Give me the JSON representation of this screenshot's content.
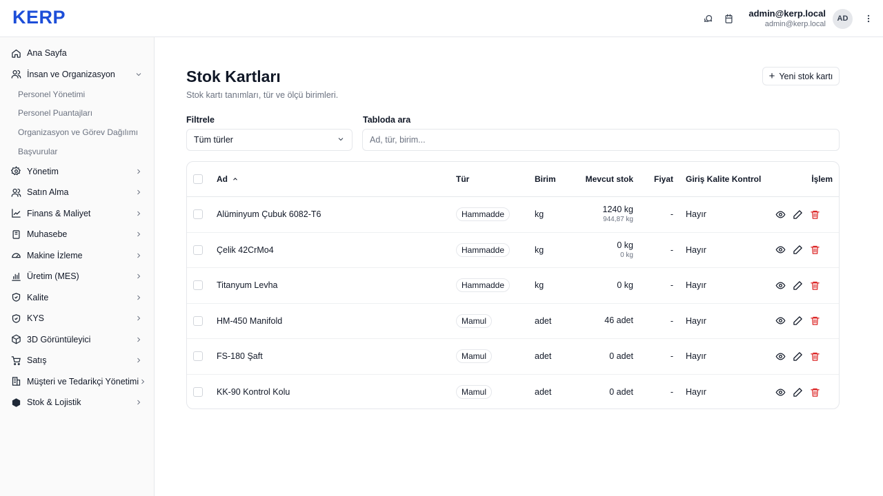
{
  "header": {
    "logo": "KERP",
    "user_name": "admin@kerp.local",
    "user_email": "admin@kerp.local",
    "avatar_initials": "AD"
  },
  "sidebar": {
    "items": [
      {
        "label": "Ana Sayfa"
      },
      {
        "label": "İnsan ve Organizasyon"
      },
      {
        "label": "Yönetim"
      },
      {
        "label": "Satın Alma"
      },
      {
        "label": "Finans & Maliyet"
      },
      {
        "label": "Muhasebe"
      },
      {
        "label": "Makine İzleme"
      },
      {
        "label": "Üretim (MES)"
      },
      {
        "label": "Kalite"
      },
      {
        "label": "KYS"
      },
      {
        "label": "3D Görüntüleyici"
      },
      {
        "label": "Satış"
      },
      {
        "label": "Müşteri ve Tedarikçi Yönetimi"
      },
      {
        "label": "Stok & Lojistik"
      }
    ],
    "sub_items": [
      {
        "label": "Personel Yönetimi"
      },
      {
        "label": "Personel Puantajları"
      },
      {
        "label": "Organizasyon ve Görev Dağılımı"
      },
      {
        "label": "Başvurular"
      }
    ]
  },
  "page": {
    "title": "Stok Kartları",
    "subtitle": "Stok kartı tanımları, tür ve ölçü birimleri.",
    "new_button": "Yeni stok kartı",
    "filter_label": "Filtrele",
    "filter_value": "Tüm türler",
    "search_label": "Tabloda ara",
    "search_placeholder": "Ad, tür, birim..."
  },
  "table": {
    "headers": {
      "ad": "Ad",
      "tur": "Tür",
      "birim": "Birim",
      "stok": "Mevcut stok",
      "fiyat": "Fiyat",
      "kk": "Giriş Kalite Kontrol",
      "islem": "İşlem"
    },
    "rows": [
      {
        "ad": "Alüminyum Çubuk 6082-T6",
        "tur": "Hammadde",
        "birim": "kg",
        "stok": "1240 kg",
        "stok_sub": "944,87 kg",
        "fiyat": "-",
        "kk": "Hayır"
      },
      {
        "ad": "Çelik 42CrMo4",
        "tur": "Hammadde",
        "birim": "kg",
        "stok": "0 kg",
        "stok_sub": "0 kg",
        "fiyat": "-",
        "kk": "Hayır"
      },
      {
        "ad": "Titanyum Levha",
        "tur": "Hammadde",
        "birim": "kg",
        "stok": "0 kg",
        "stok_sub": "",
        "fiyat": "-",
        "kk": "Hayır"
      },
      {
        "ad": "HM-450 Manifold",
        "tur": "Mamul",
        "birim": "adet",
        "stok": "46 adet",
        "stok_sub": "",
        "fiyat": "-",
        "kk": "Hayır"
      },
      {
        "ad": "FS-180 Şaft",
        "tur": "Mamul",
        "birim": "adet",
        "stok": "0 adet",
        "stok_sub": "",
        "fiyat": "-",
        "kk": "Hayır"
      },
      {
        "ad": "KK-90 Kontrol Kolu",
        "tur": "Mamul",
        "birim": "adet",
        "stok": "0 adet",
        "stok_sub": "",
        "fiyat": "-",
        "kk": "Hayır"
      }
    ]
  },
  "colors": {
    "brand": "#1d4ed8",
    "danger": "#dc2626",
    "border": "#e5e7eb"
  }
}
